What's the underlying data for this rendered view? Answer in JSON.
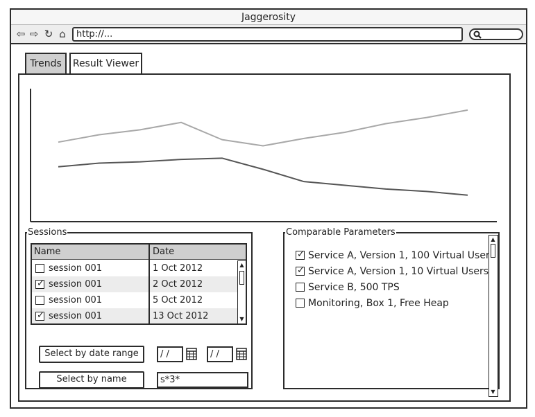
{
  "window": {
    "title": "Jaggerosity"
  },
  "toolbar": {
    "back_icon": "arrow-left-icon",
    "forward_icon": "arrow-right-icon",
    "reload_icon": "reload-icon",
    "home_icon": "home-icon",
    "address": "http://...",
    "search_value": ""
  },
  "tabs": [
    {
      "label": "Trends",
      "active": true
    },
    {
      "label": "Result Viewer",
      "active": false
    }
  ],
  "chart_data": {
    "type": "line",
    "title": "",
    "xlabel": "",
    "ylabel": "",
    "grid": false,
    "legend": "none",
    "x": [
      0,
      1,
      2,
      3,
      4,
      5,
      6,
      7,
      8,
      9,
      10
    ],
    "series": [
      {
        "values": [
          60,
          66,
          70,
          76,
          62,
          57,
          63,
          68,
          75,
          80,
          86
        ],
        "color": "#a8a8a8"
      },
      {
        "values": [
          40,
          43,
          44,
          46,
          47,
          38,
          28,
          25,
          22,
          20,
          17
        ],
        "color": "#555555"
      }
    ],
    "ylim": [
      0,
      100
    ],
    "xlim": [
      0,
      10
    ]
  },
  "sessions": {
    "legend": "Sessions",
    "columns": {
      "name": "Name",
      "date": "Date"
    },
    "rows": [
      {
        "name": "session 001",
        "date": "1 Oct 2012",
        "checked": false
      },
      {
        "name": "session 001",
        "date": "2 Oct 2012",
        "checked": true
      },
      {
        "name": "session 001",
        "date": "5 Oct 2012",
        "checked": false
      },
      {
        "name": "session 001",
        "date": "13 Oct 2012",
        "checked": true
      }
    ],
    "select_by_date_label": "Select by date range",
    "date_from": "/ /",
    "date_to": "/ /",
    "select_by_name_label": "Select by name",
    "name_filter": "s*3*"
  },
  "params": {
    "legend": "Comparable Parameters",
    "items": [
      {
        "label": "Service A, Version 1, 100 Virtual Users",
        "checked": true
      },
      {
        "label": "Service A, Version 1, 10 Virtual Users",
        "checked": true
      },
      {
        "label": "Service B, 500 TPS",
        "checked": false
      },
      {
        "label": "Monitoring, Box 1, Free Heap",
        "checked": false
      }
    ]
  }
}
